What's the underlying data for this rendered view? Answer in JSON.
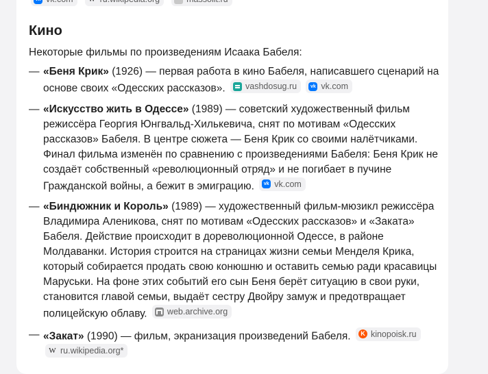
{
  "top_sources": [
    "vk.com",
    "ru.wikipedia.org",
    "massolit.ru"
  ],
  "section": {
    "title": "Кино",
    "intro": "Некоторые фильмы по произведениям Исаака Бабеля:"
  },
  "dash": "—",
  "films": [
    {
      "title": "«Беня Крик»",
      "text": " (1926) — первая работа в кино Бабеля, написавшего сценарий на основе своих «Одесских рассказов».",
      "sources": [
        {
          "label": "vashdosug.ru",
          "icon": "vashdosug-icon"
        },
        {
          "label": "vk.com",
          "icon": "vk-icon"
        }
      ]
    },
    {
      "title": "«Искусство жить в Одессе»",
      "text": " (1989) — советский художественный фильм режиссёра Георгия Юнгвальд-Хилькевича, снят по мотивам «Одесских рассказов» Бабеля. В центре сюжета — Беня Крик со своими налётчиками. Финал фильма изменён по сравнению с произведениями Бабеля: Беня Крик не создаёт собственный «революционный отряд» и не погибает в пучине Гражданской войны, а бежит в эмиграцию.",
      "sources": [
        {
          "label": "vk.com",
          "icon": "vk-icon"
        }
      ]
    },
    {
      "title": "«Биндюжник и Король»",
      "text": " (1989) — художественный фильм-мюзикл режиссёра Владимира Аленикова, снят по мотивам «Одесских рассказов» и «Заката» Бабеля. Действие происходит в дореволюционной Одессе, в районе Молдаванки. История строится на страницах жизни семьи Менделя Крика, который собирается продать свою конюшню и оставить семью ради красавицы Маруськи. На фоне этих событий его сын Беня берёт ситуацию в свои руки, становится главой семьи, выдаёт сестру Двойру замуж и предотвращает полицейскую облаву.",
      "sources": [
        {
          "label": "web.archive.org",
          "icon": "archive-icon"
        }
      ]
    },
    {
      "title": "«Закат»",
      "text": " (1990) — фильм, экранизация произведений Бабеля.",
      "sources": [
        {
          "label": "kinopoisk.ru",
          "icon": "kinopoisk-icon"
        },
        {
          "label": "ru.wikipedia.org*",
          "icon": "wikipedia-icon"
        }
      ]
    }
  ]
}
